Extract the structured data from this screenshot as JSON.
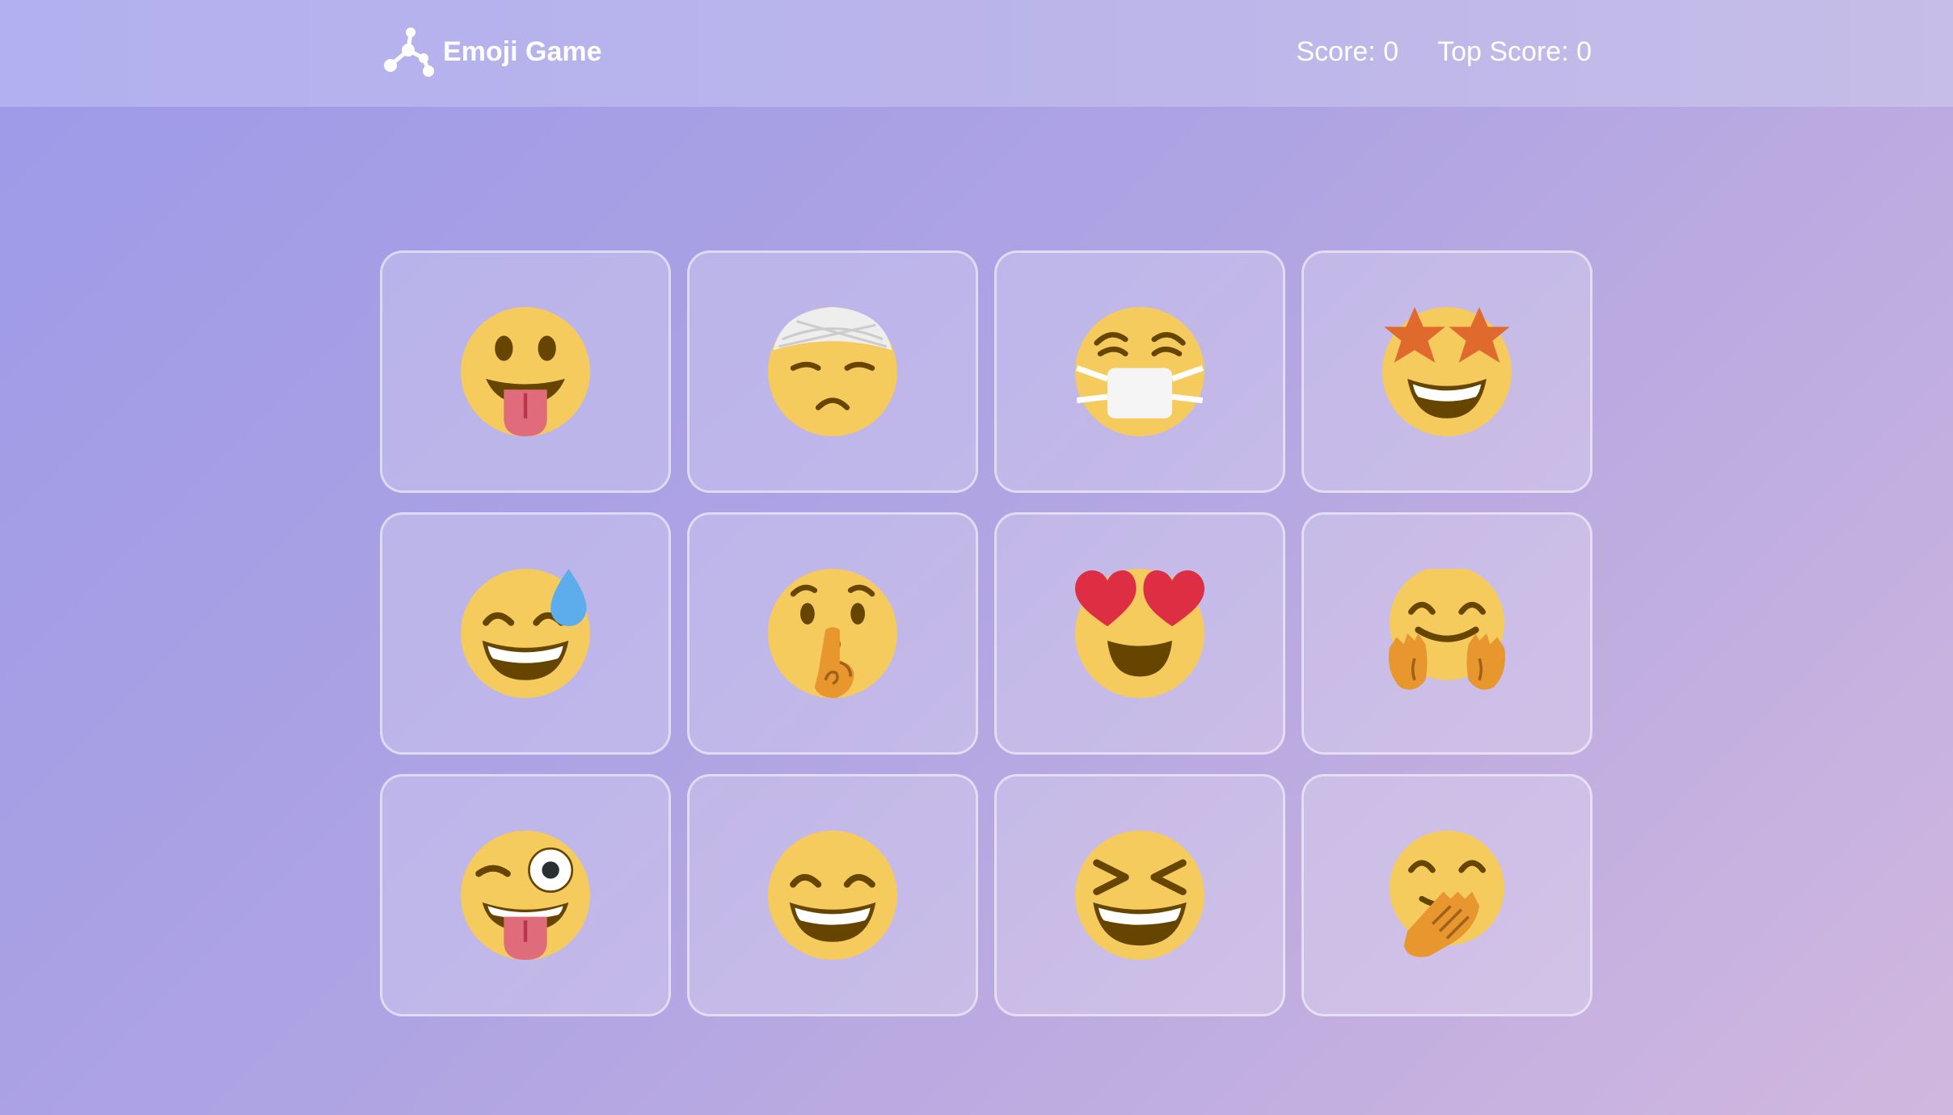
{
  "header": {
    "app_name": "Emoji Game",
    "logo_icon": "molecule-icon",
    "score_text": "Score: 0",
    "top_score_text": "Top Score: 0"
  },
  "cards": [
    {
      "icon": "face-with-tongue-icon"
    },
    {
      "icon": "face-with-head-bandage-icon"
    },
    {
      "icon": "face-with-medical-mask-icon"
    },
    {
      "icon": "star-struck-icon"
    },
    {
      "icon": "grinning-face-with-sweat-icon"
    },
    {
      "icon": "shushing-face-icon"
    },
    {
      "icon": "smiling-face-with-heart-eyes-icon"
    },
    {
      "icon": "hugging-face-icon"
    },
    {
      "icon": "winking-face-with-tongue-icon"
    },
    {
      "icon": "grinning-face-with-smiling-eyes-icon"
    },
    {
      "icon": "grinning-squinting-face-icon"
    },
    {
      "icon": "face-with-hand-over-mouth-icon"
    }
  ],
  "colors": {
    "face": "#F6CB5D",
    "mouth": "#664500",
    "tongue": "#E06B7A",
    "heart": "#DD2E44",
    "star": "#E06A2E",
    "hand": "#E8962E",
    "drop": "#5DADEC"
  }
}
